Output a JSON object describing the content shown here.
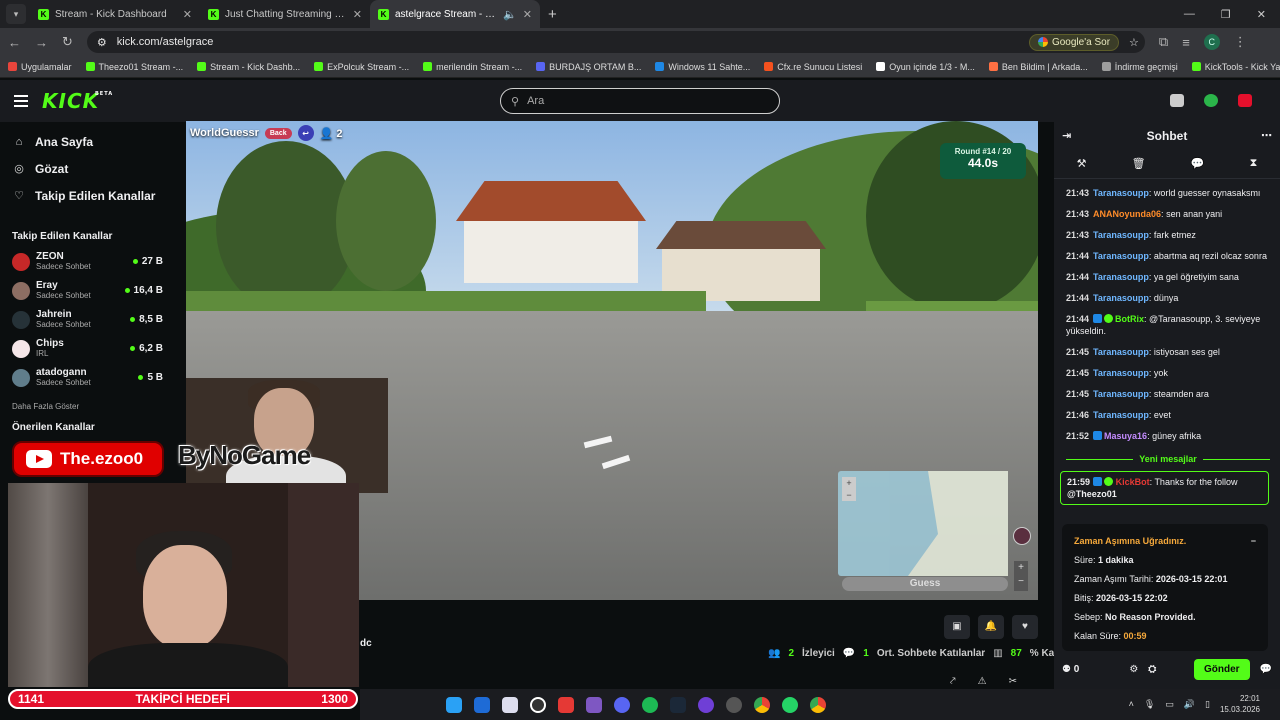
{
  "browser": {
    "tabs": [
      {
        "title": "Stream - Kick Dashboard",
        "active": false
      },
      {
        "title": "Just Chatting Streaming - Live",
        "active": false
      },
      {
        "title": "astelgrace Stream - Watch",
        "active": true
      }
    ],
    "url": "kick.com/astelgrace",
    "google_button": "Google'a Sor",
    "profile_initial": "C",
    "bookmarks": [
      "Uygulamalar",
      "Theezo01 Stream -...",
      "Stream - Kick Dashb...",
      "ExPolcuk Stream -...",
      "merilendin Stream -...",
      "BURDAJŞ ORTAM B...",
      "Windows 11 Sahte...",
      "Cfx.re Sunucu Listesi",
      "Oyun içinde 1/3 - M...",
      "Ben Bildim | Arkada...",
      "İndirme geçmişi",
      "KickTools - Kick Yara..."
    ]
  },
  "kick": {
    "logo": "KICK",
    "logo_badge": "BETA",
    "search_placeholder": "Ara"
  },
  "sidebar": {
    "nav": [
      {
        "label": "Ana Sayfa",
        "icon": "home-icon"
      },
      {
        "label": "Gözat",
        "icon": "compass-icon"
      },
      {
        "label": "Takip Edilen Kanallar",
        "icon": "heart-icon"
      }
    ],
    "followed_header": "Takip Edilen Kanallar",
    "channels": [
      {
        "name": "ZEON",
        "sub": "Sadece Sohbet",
        "viewers": "27 B",
        "color": "#c62828"
      },
      {
        "name": "Eray",
        "sub": "Sadece Sohbet",
        "viewers": "16,4 B",
        "color": "#8d6e63"
      },
      {
        "name": "Jahrein",
        "sub": "Sadece Sohbet",
        "viewers": "8,5 B",
        "color": "#263238"
      },
      {
        "name": "Chips",
        "sub": "IRL",
        "viewers": "6,2 B",
        "color": "#f5e6e8"
      },
      {
        "name": "atadogann",
        "sub": "Sadece Sohbet",
        "viewers": "5 B",
        "color": "#607d8b"
      }
    ],
    "show_more": "Daha Fazla Göster",
    "recommended_header": "Önerilen Kanallar"
  },
  "stream": {
    "game_title": "WorldGuessr",
    "back_label": "Back",
    "players": "2",
    "round_label": "Round #14 / 20",
    "timer": "44.0s",
    "guess_label": "Guess",
    "overlay_youtube": "The.ezoo0",
    "overlay_sponsor": "ByNoGame",
    "chat_fragment": "dc"
  },
  "stats": {
    "viewers_count": "2",
    "viewers_label": "İzleyici",
    "chatters_count": "1",
    "chatters_label": "Ort. Sohbete Katılanlar",
    "engagement_value": "87",
    "engagement_label": "% Katılım"
  },
  "chat": {
    "title": "Sohbet",
    "messages": [
      {
        "time": "21:43",
        "user": "Taranasoupp",
        "color": "#6fb7ff",
        "text": "world guesser oynasaksmı"
      },
      {
        "time": "21:43",
        "user": "ANANoyunda06",
        "color": "#ff8c2a",
        "text": "sen anan yani"
      },
      {
        "time": "21:43",
        "user": "Taranasoupp",
        "color": "#6fb7ff",
        "text": "fark etmez"
      },
      {
        "time": "21:44",
        "user": "Taranasoupp",
        "color": "#6fb7ff",
        "text": "abartma aq rezil olcaz sonra"
      },
      {
        "time": "21:44",
        "user": "Taranasoupp",
        "color": "#6fb7ff",
        "text": "ya gel öğretiyim sana"
      },
      {
        "time": "21:44",
        "user": "Taranasoupp",
        "color": "#6fb7ff",
        "text": "dünya"
      },
      {
        "time": "21:44",
        "user": "BotRix",
        "color": "#53fc18",
        "text": "@Taranasoupp, 3. seviyeye yükseldin.",
        "badges": true
      },
      {
        "time": "21:45",
        "user": "Taranasoupp",
        "color": "#6fb7ff",
        "text": "istiyosan ses gel"
      },
      {
        "time": "21:45",
        "user": "Taranasoupp",
        "color": "#6fb7ff",
        "text": "yok"
      },
      {
        "time": "21:45",
        "user": "Taranasoupp",
        "color": "#6fb7ff",
        "text": "steamden ara"
      },
      {
        "time": "21:46",
        "user": "Taranasoupp",
        "color": "#6fb7ff",
        "text": "evet"
      },
      {
        "time": "21:52",
        "user": "Masuya16",
        "color": "#c48cff",
        "text": "güney afrika",
        "badges": true
      }
    ],
    "new_messages_label": "Yeni mesajlar",
    "pinned": {
      "time": "21:59",
      "user": "KickBot",
      "text": "Thanks for the follow",
      "mention": "@Theezo01"
    },
    "timeout": {
      "title": "Zaman Aşımına Uğradınız.",
      "duration_label": "Süre:",
      "duration_value": "1 dakika",
      "date_label": "Zaman Aşımı Tarihi:",
      "date_value": "2026-03-15 22:01",
      "end_label": "Bitiş:",
      "end_value": "2026-03-15 22:02",
      "reason_label": "Sebep:",
      "reason_value": "No Reason Provided.",
      "remaining_label": "Kalan Süre:",
      "remaining_value": "00:59"
    },
    "points": "0",
    "send_label": "Gönder"
  },
  "goal": {
    "current": "1141",
    "label": "TAKİPCİ HEDEFİ",
    "target": "1300"
  },
  "taskbar": {
    "time": "22:01",
    "date": "15.03.2026"
  },
  "colors": {
    "accent": "#53fc18",
    "chat_bg": "#191b1f",
    "page_bg": "#0b0e0f",
    "goal_red": "#e4102c"
  }
}
